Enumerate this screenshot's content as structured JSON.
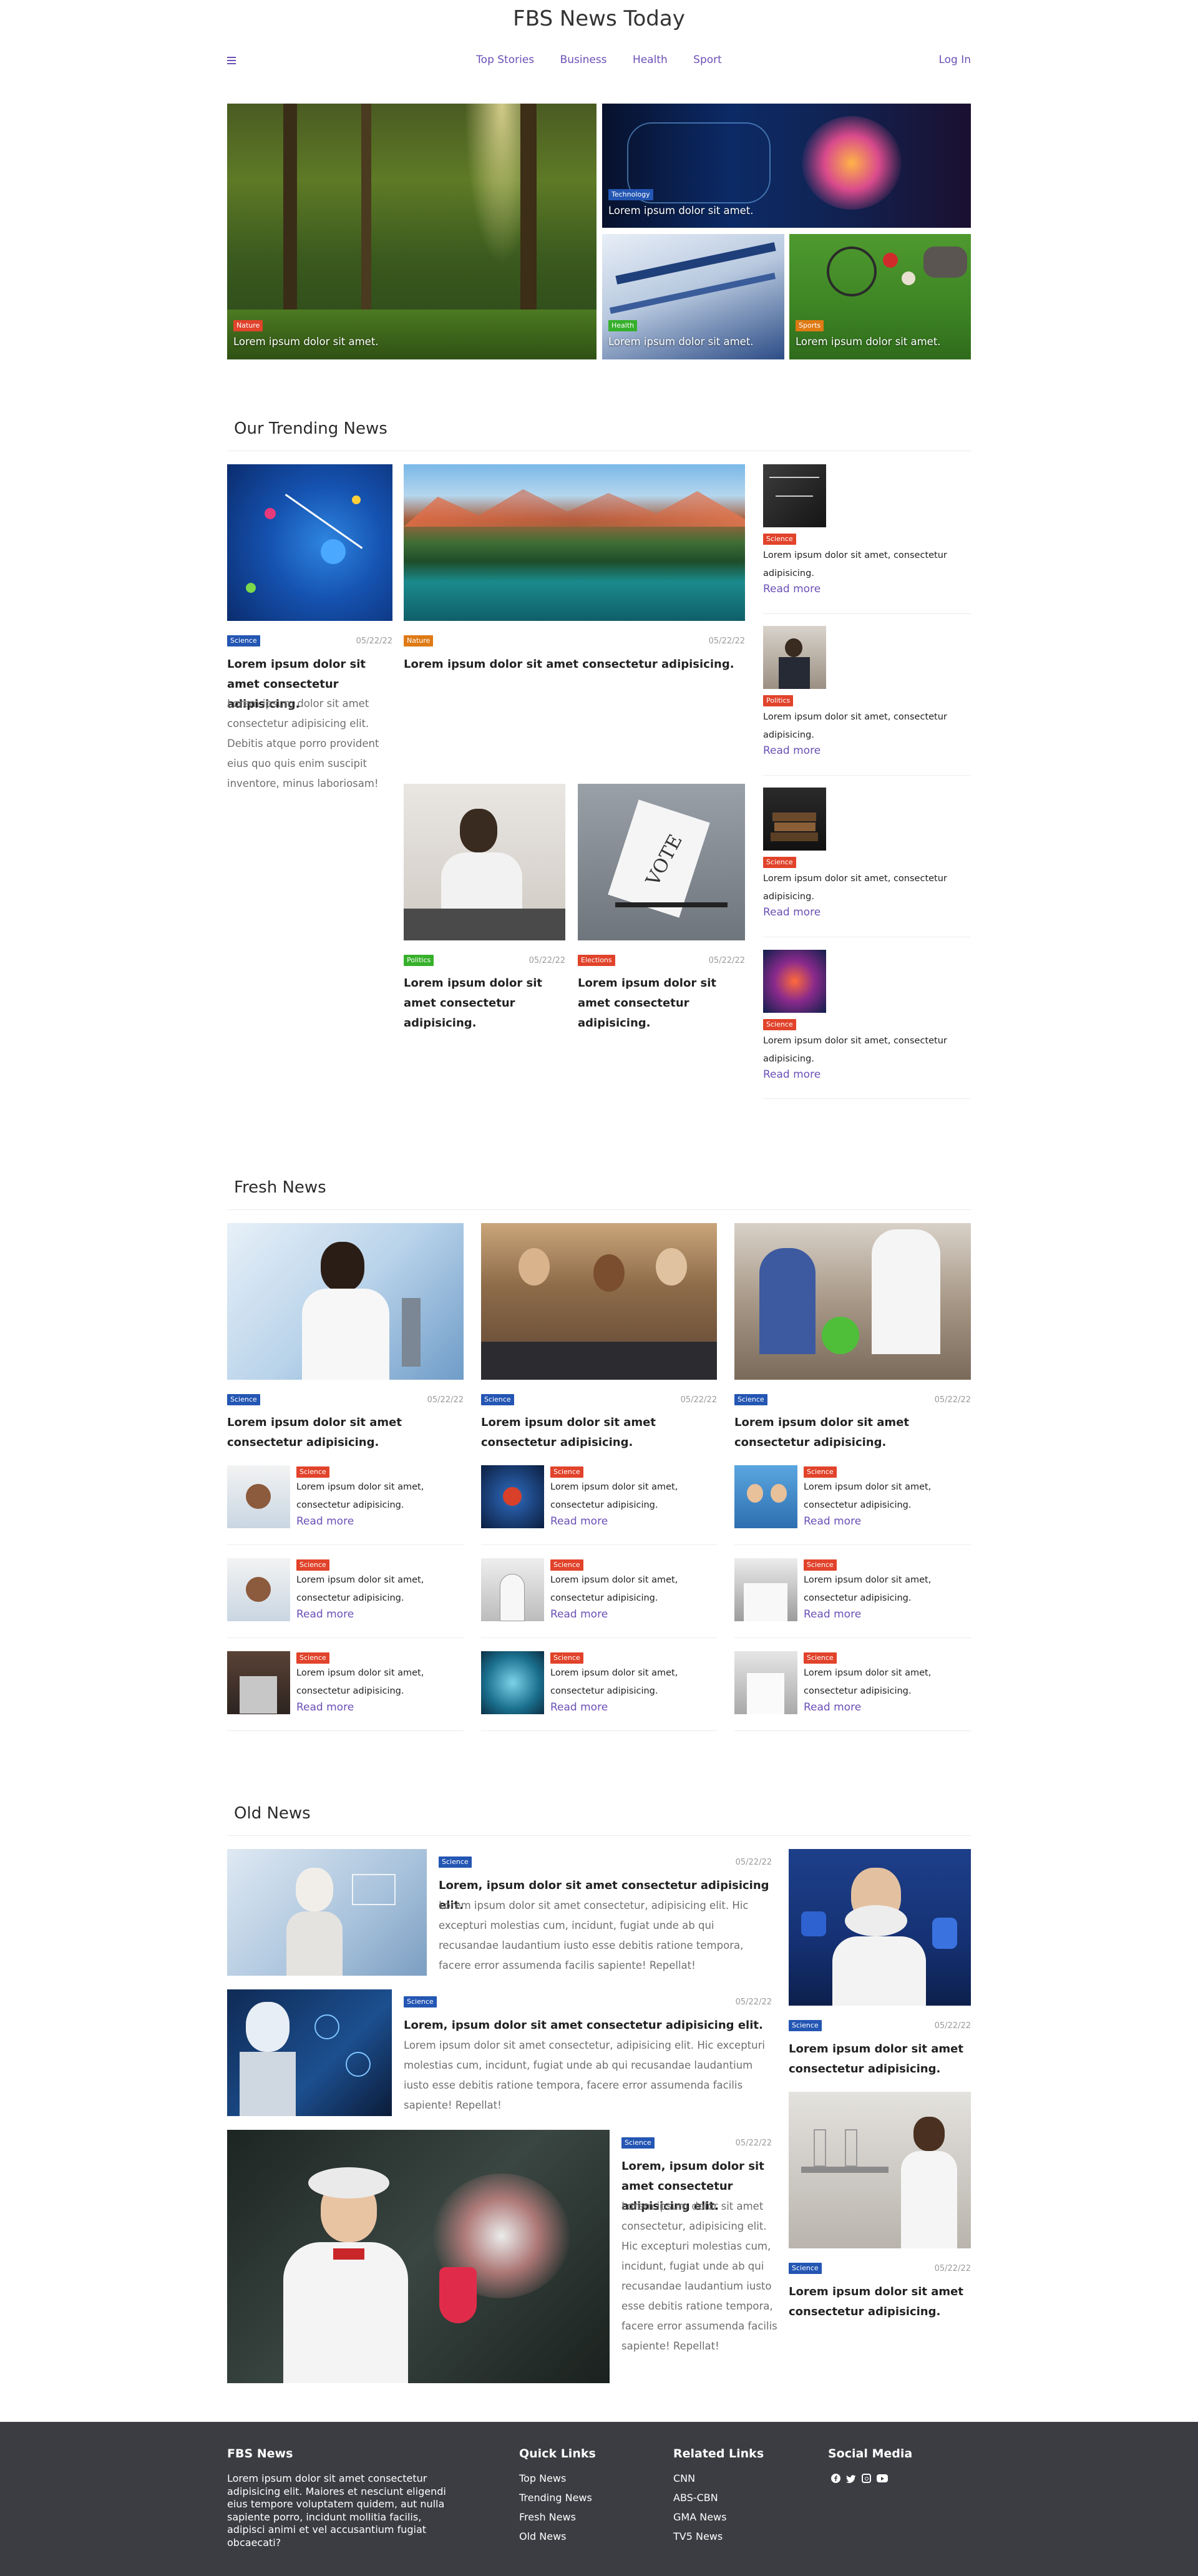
{
  "site": {
    "title": "FBS News Today",
    "login": "Log In"
  },
  "nav": [
    "Top Stories",
    "Business",
    "Health",
    "Sport"
  ],
  "colors": {
    "accent": "#6a4fb5",
    "science": "#2456b3",
    "red_tag": "#e1432b",
    "green_tag": "#36b02b",
    "orange_tag": "#df7a14",
    "footer_bg": "#3c3d43"
  },
  "hero": {
    "main": {
      "tag": "Nature",
      "caption": "Lorem ipsum dolor sit amet."
    },
    "tech": {
      "tag": "Technology",
      "caption": "Lorem ipsum dolor sit amet."
    },
    "health": {
      "tag": "Health",
      "caption": "Lorem ipsum dolor sit amet."
    },
    "sports": {
      "tag": "Sports",
      "caption": "Lorem ipsum dolor sit amet."
    }
  },
  "trending": {
    "heading": "Our Trending News",
    "main": {
      "tag": "Science",
      "date": "05/22/22",
      "title": "Lorem ipsum dolor sit amet consectetur adipisicing.",
      "body": "Lorem ipsum dolor sit amet consectetur adipisicing elit. Debitis atque porro provident eius quo quis enim suscipit inventore, minus laboriosam!"
    },
    "wide": {
      "tag": "Nature",
      "date": "05/22/22",
      "title": "Lorem ipsum dolor sit amet consectetur adipisicing."
    },
    "politics": {
      "tag": "Politics",
      "date": "05/22/22",
      "title": "Lorem ipsum dolor sit amet consectetur adipisicing."
    },
    "elections": {
      "tag": "Elections",
      "date": "05/22/22",
      "title": "Lorem ipsum dolor sit amet consectetur adipisicing."
    },
    "side": [
      {
        "tag": "Science",
        "text": "Lorem ipsum dolor sit amet, consectetur adipisicing.",
        "more": "Read more"
      },
      {
        "tag": "Politics",
        "text": "Lorem ipsum dolor sit amet, consectetur adipisicing.",
        "more": "Read more"
      },
      {
        "tag": "Science",
        "text": "Lorem ipsum dolor sit amet, consectetur adipisicing.",
        "more": "Read more"
      },
      {
        "tag": "Science",
        "text": "Lorem ipsum dolor sit amet, consectetur adipisicing.",
        "more": "Read more"
      }
    ]
  },
  "fresh": {
    "heading": "Fresh News",
    "columns": [
      {
        "tag": "Science",
        "date": "05/22/22",
        "title": "Lorem ipsum dolor sit amet consectetur adipisicing.",
        "items": [
          {
            "tag": "Science",
            "text": "Lorem ipsum dolor sit amet, consectetur adipisicing.",
            "more": "Read more"
          },
          {
            "tag": "Science",
            "text": "Lorem ipsum dolor sit amet, consectetur adipisicing.",
            "more": "Read more"
          },
          {
            "tag": "Science",
            "text": "Lorem ipsum dolor sit amet, consectetur adipisicing.",
            "more": "Read more"
          }
        ]
      },
      {
        "tag": "Science",
        "date": "05/22/22",
        "title": "Lorem ipsum dolor sit amet consectetur adipisicing.",
        "items": [
          {
            "tag": "Science",
            "text": "Lorem ipsum dolor sit amet, consectetur adipisicing.",
            "more": "Read more"
          },
          {
            "tag": "Science",
            "text": "Lorem ipsum dolor sit amet, consectetur adipisicing.",
            "more": "Read more"
          },
          {
            "tag": "Science",
            "text": "Lorem ipsum dolor sit amet, consectetur adipisicing.",
            "more": "Read more"
          }
        ]
      },
      {
        "tag": "Science",
        "date": "05/22/22",
        "title": "Lorem ipsum dolor sit amet consectetur adipisicing.",
        "items": [
          {
            "tag": "Science",
            "text": "Lorem ipsum dolor sit amet, consectetur adipisicing.",
            "more": "Read more"
          },
          {
            "tag": "Science",
            "text": "Lorem ipsum dolor sit amet, consectetur adipisicing.",
            "more": "Read more"
          },
          {
            "tag": "Science",
            "text": "Lorem ipsum dolor sit amet, consectetur adipisicing.",
            "more": "Read more"
          }
        ]
      }
    ]
  },
  "old": {
    "heading": "Old News",
    "row1": {
      "tag": "Science",
      "date": "05/22/22",
      "title": "Lorem, ipsum dolor sit amet consectetur adipisicing elit.",
      "body": "Lorem ipsum dolor sit amet consectetur, adipisicing elit. Hic excepturi molestias cum, incidunt, fugiat unde ab qui recusandae laudantium iusto esse debitis ratione tempora, facere error assumenda facilis sapiente! Repellat!"
    },
    "row2": {
      "tag": "Science",
      "date": "05/22/22",
      "title": "Lorem, ipsum dolor sit amet consectetur adipisicing elit.",
      "body": "Lorem ipsum dolor sit amet consectetur, adipisicing elit. Hic excepturi molestias cum, incidunt, fugiat unde ab qui recusandae laudantium iusto esse debitis ratione tempora, facere error assumenda facilis sapiente! Repellat!"
    },
    "row3": {
      "tag": "Science",
      "date": "05/22/22",
      "title": "Lorem, ipsum dolor sit amet consectetur adipisicing elit.",
      "body": "Lorem ipsum dolor sit amet consectetur, adipisicing elit. Hic excepturi molestias cum, incidunt, fugiat unde ab qui recusandae laudantium iusto esse debitis ratione tempora, facere error assumenda facilis sapiente! Repellat!"
    },
    "side1": {
      "tag": "Science",
      "date": "05/22/22",
      "title": "Lorem ipsum dolor sit amet consectetur adipisicing."
    },
    "side2": {
      "tag": "Science",
      "date": "05/22/22",
      "title": "Lorem ipsum dolor sit amet consectetur adipisicing."
    }
  },
  "footer": {
    "brand": "FBS News",
    "about": "Lorem ipsum dolor sit amet consectetur adipisicing elit. Maiores et nesciunt eligendi eius tempore voluptatem quidem, aut nulla sapiente porro, incidunt mollitia facilis, adipisci animi et vel accusantium fugiat obcaecati?",
    "quick_heading": "Quick Links",
    "quick": [
      "Top News",
      "Trending News",
      "Fresh News",
      "Old News"
    ],
    "related_heading": "Related Links",
    "related": [
      "CNN",
      "ABS-CBN",
      "GMA News",
      "TV5 News"
    ],
    "social_heading": "Social Media",
    "social_icons": [
      "facebook-icon",
      "twitter-icon",
      "instagram-icon",
      "youtube-icon"
    ]
  }
}
